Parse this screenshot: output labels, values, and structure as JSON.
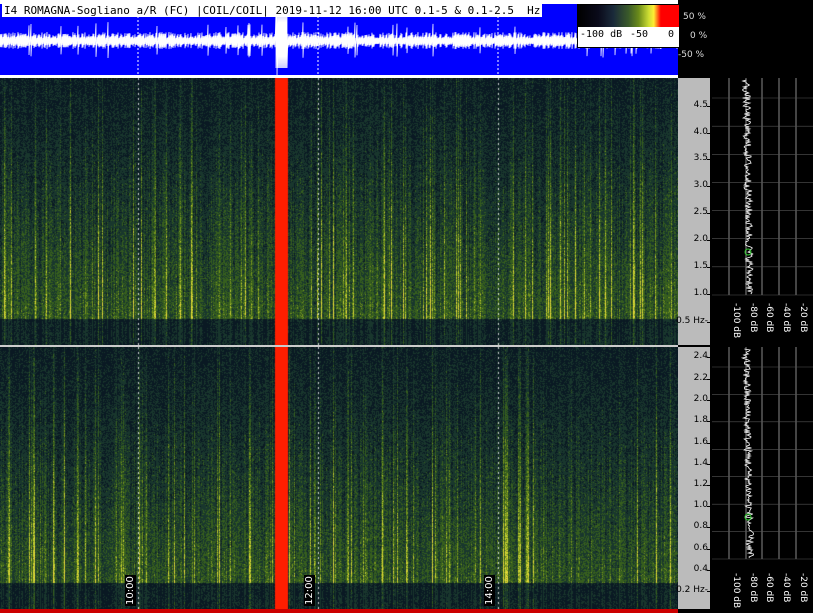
{
  "header": {
    "title": "I4 ROMAGNA-Sogliano a/R (FC) |COIL/COIL| 2019-11-12 16:00 UTC 0.1-5 & 0.1-2.5  Hz"
  },
  "colorbar": {
    "labels": [
      "-100 dB",
      "-50",
      "0"
    ]
  },
  "amplitude_axis": {
    "labels": [
      "50 %",
      "0 %",
      "-50 %"
    ]
  },
  "freq_axis_top": {
    "unit_label": "0.5 Hz-",
    "ticks": [
      "4.5",
      "4.0",
      "3.5",
      "3.0",
      "2.5",
      "2.0",
      "1.5",
      "1.0"
    ]
  },
  "freq_axis_bottom": {
    "unit_label": "0.2 Hz-",
    "ticks": [
      "2.4",
      "2.2",
      "2.0",
      "1.8",
      "1.6",
      "1.4",
      "1.2",
      "1.0",
      "0.8",
      "0.6",
      "0.4"
    ]
  },
  "profile_db_labels_top": [
    "-100 dB",
    "-80 dB",
    "-60 dB",
    "-40 dB",
    "-20 dB"
  ],
  "profile_db_labels_bottom": [
    "-100 dB",
    "-80 dB",
    "-60 dB",
    "-40 dB",
    "-20 dB"
  ],
  "time_labels": [
    "10:00",
    "12:00",
    "14:00"
  ],
  "colors": {
    "header_blue": "#0000ff",
    "burst_red": "#ff2200",
    "spectro_dark": "#0c1a22",
    "spectro_green": "#3f6a1e",
    "spectro_yellow": "#d8e040"
  }
}
